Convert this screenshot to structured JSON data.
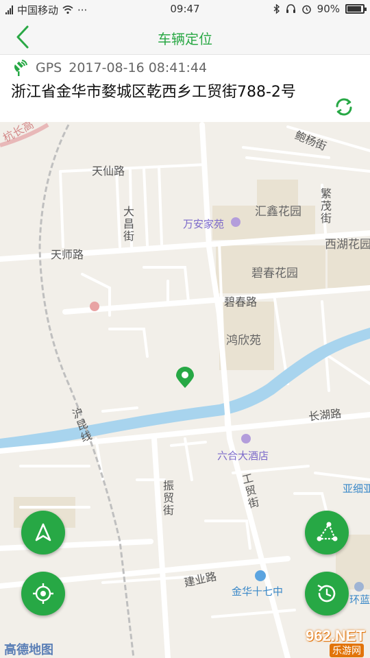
{
  "status_bar": {
    "carrier": "中国移动",
    "dots": "···",
    "time": "09:47",
    "battery": "90%",
    "battery_level": 0.9
  },
  "header": {
    "title": "车辆定位",
    "back_icon": "chevron-left-icon"
  },
  "location": {
    "source": "GPS",
    "timestamp": "2017-08-16 08:41:44",
    "address": "浙江省金华市婺城区乾西乡工贸街788-2号",
    "refresh_icon": "refresh-icon"
  },
  "map": {
    "labels": {
      "hangchang": "杭长高",
      "baoyang": "鲍杨街",
      "tianxian": "天仙路",
      "dachang": "大昌街",
      "huixin": "汇鑫花园",
      "fanmao": "繁茂街",
      "wanan": "万安家苑",
      "xihu": "西湖花园",
      "tianshi": "天师路",
      "bichun_garden": "碧春花园",
      "bichun_road": "碧春路",
      "hongxin": "鸿欣苑",
      "changhu": "长湖路",
      "huhun": "沪昆线",
      "liuhe": "六合大酒店",
      "yaxi": "亚细亚",
      "gongmao": "工贸街",
      "zhenmao": "振贸街",
      "jianye": "建业路",
      "shiqi": "金华十七中",
      "huanlan": "环蓝"
    },
    "logo": "高德地图",
    "colors": {
      "accent": "#27a845",
      "river": "#a8d4ee",
      "road": "#ffffff",
      "block": "#e9e2d2"
    }
  },
  "controls": {
    "navigate_icon": "navigation-arrow-icon",
    "locate_icon": "crosshair-icon",
    "route_icon": "route-triangle-icon",
    "history_icon": "history-clock-icon"
  },
  "watermark": {
    "site": "962.NET",
    "sub": "乐游网"
  }
}
